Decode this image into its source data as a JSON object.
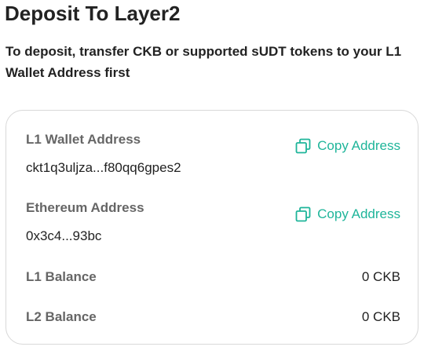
{
  "title": "Deposit To Layer2",
  "subtitle": "To deposit, transfer CKB or supported sUDT tokens to your L1 Wallet Address first",
  "card": {
    "l1_wallet": {
      "label": "L1 Wallet Address",
      "value": "ckt1q3uljza...f80qq6gpes2",
      "copy_label": "Copy Address"
    },
    "ethereum": {
      "label": "Ethereum Address",
      "value": "0x3c4...93bc",
      "copy_label": "Copy Address"
    },
    "l1_balance": {
      "label": "L1 Balance",
      "value": "0 CKB"
    },
    "l2_balance": {
      "label": "L2 Balance",
      "value": "0 CKB"
    }
  },
  "colors": {
    "accent": "#1fb59a",
    "label": "#666666",
    "text": "#222222",
    "border": "#d8d8d8"
  },
  "icons": {
    "copy": "copy-icon"
  }
}
